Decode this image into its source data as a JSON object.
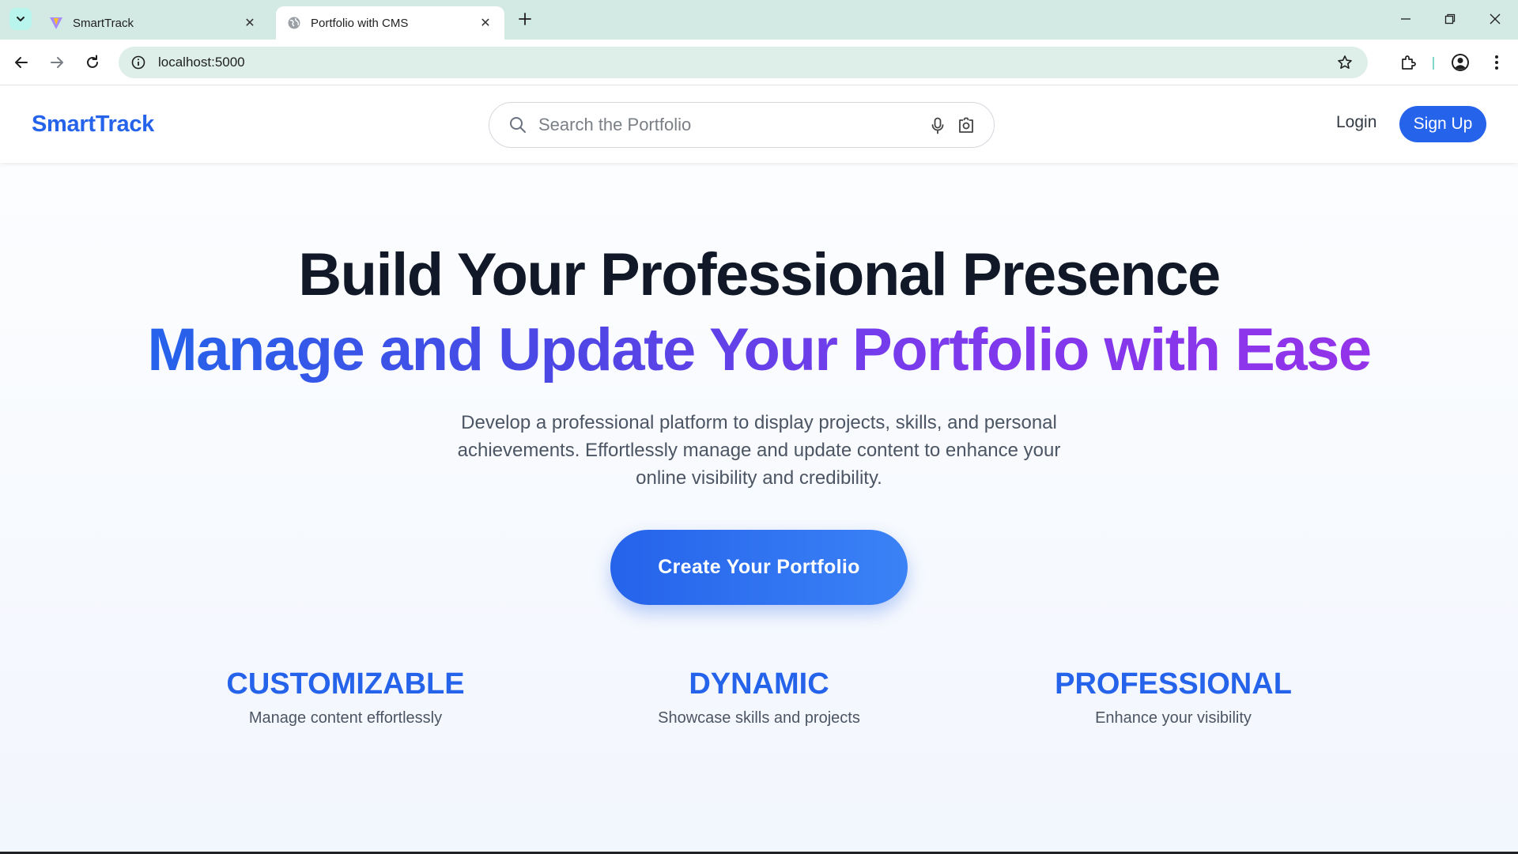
{
  "browser": {
    "tabs": [
      {
        "title": "SmartTrack",
        "active": false
      },
      {
        "title": "Portfolio with CMS",
        "active": true
      }
    ],
    "url": "localhost:5000"
  },
  "site": {
    "logo": "SmartTrack",
    "search_placeholder": "Search the Portfolio",
    "login_label": "Login",
    "signup_label": "Sign Up"
  },
  "hero": {
    "title": "Build Your Professional Presence",
    "subtitle": "Manage and Update Your Portfolio with Ease",
    "description": "Develop a professional platform to display projects, skills, and personal achievements. Effortlessly manage and update content to enhance your online visibility and credibility.",
    "cta_label": "Create Your Portfolio"
  },
  "features": [
    {
      "title": "CUSTOMIZABLE",
      "description": "Manage content effortlessly"
    },
    {
      "title": "DYNAMIC",
      "description": "Showcase skills and projects"
    },
    {
      "title": "PROFESSIONAL",
      "description": "Enhance your visibility"
    }
  ],
  "colors": {
    "brand": "#2563eb",
    "gradient_start": "#2563eb",
    "gradient_end": "#9333ea",
    "heading": "#111827",
    "body_text": "#4b5563"
  },
  "icons": [
    "tab-search-icon",
    "vite-favicon-icon",
    "globe-favicon-icon",
    "close-icon",
    "plus-icon",
    "minimize-icon",
    "restore-icon",
    "back-icon",
    "forward-icon",
    "reload-icon",
    "info-icon",
    "star-icon",
    "extensions-icon",
    "profile-icon",
    "kebab-menu-icon",
    "search-icon",
    "mic-icon",
    "lens-icon"
  ]
}
